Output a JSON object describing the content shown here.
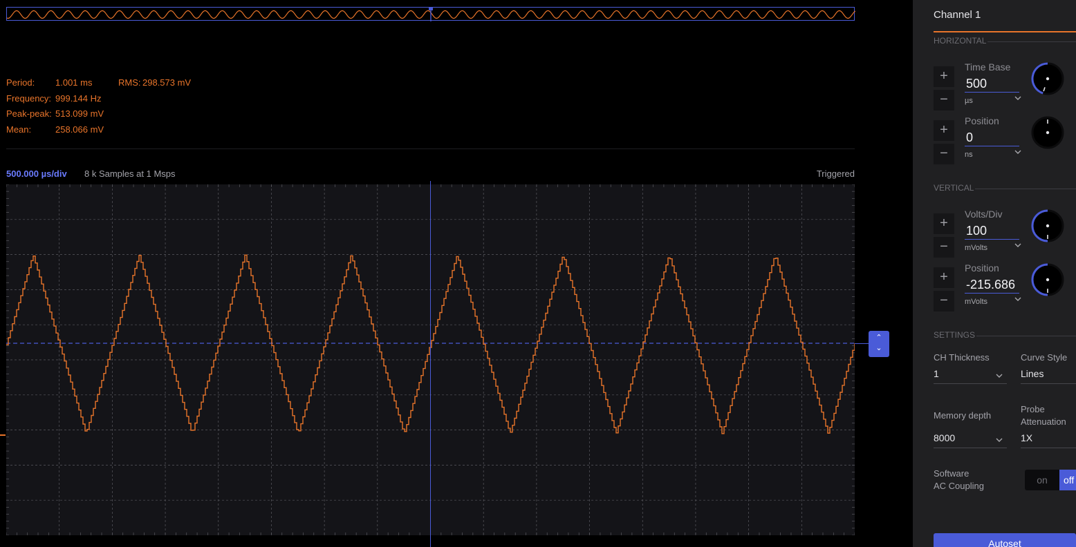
{
  "overview": {
    "label_hidden": ""
  },
  "measurements": [
    {
      "label": "Period:",
      "value": "1.001 ms"
    },
    {
      "label": "Frequency:",
      "value": "999.144 Hz"
    },
    {
      "label": "Peak-peak:",
      "value": "513.099 mV"
    },
    {
      "label": "Mean:",
      "value": "258.066 mV"
    },
    {
      "label": "RMS:",
      "value": "298.573 mV"
    }
  ],
  "plot": {
    "timebase_label": "500.000 µs/div",
    "samples_label": "8 k Samples at 1 Msps",
    "trigger_status": "Triggered"
  },
  "panel": {
    "title": "Channel 1",
    "horizontal_header": "HORIZONTAL",
    "vertical_header": "VERTICAL",
    "settings_header": "SETTINGS",
    "time_base": {
      "label": "Time Base",
      "value": "500",
      "unit": "µs",
      "knob_fraction": 0.45
    },
    "h_position": {
      "label": "Position",
      "value": "0",
      "unit": "ns",
      "knob_fraction": 0.0
    },
    "volts_div": {
      "label": "Volts/Div",
      "value": "100",
      "unit": "mVolts",
      "knob_fraction": 0.5
    },
    "v_position": {
      "label": "Position",
      "value": "-215.686",
      "unit": "mVolts",
      "knob_fraction": 0.5
    },
    "ch_thickness": {
      "label": "CH Thickness",
      "value": "1"
    },
    "curve_style": {
      "label": "Curve Style",
      "value": "Lines"
    },
    "memory_depth": {
      "label": "Memory depth",
      "value": "8000"
    },
    "probe_attenuation": {
      "label_line1": "Probe",
      "label_line2": "Attenuation",
      "value": "1X"
    },
    "ac_coupling": {
      "label_line1": "Software",
      "label_line2": "AC Coupling",
      "on_label": "on",
      "off_label": "off"
    },
    "autoset_label": "Autoset"
  },
  "colors": {
    "signal": "#e8742a",
    "accent": "#4a5bd8",
    "plot_bg": "#141418",
    "grid": "#5a5a60"
  }
}
